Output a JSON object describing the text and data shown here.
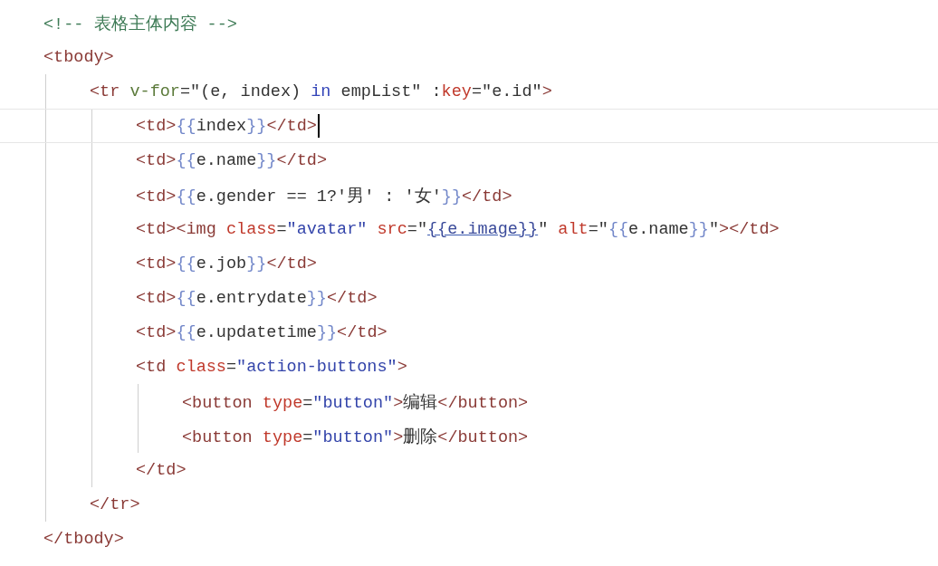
{
  "code_lines": [
    {
      "tokens": [
        {
          "kind": "comment",
          "text": "<!-- 表格主体内容 -->"
        }
      ]
    },
    {
      "tokens": [
        {
          "kind": "tag",
          "text": "<tbody>"
        }
      ],
      "children": [
        {
          "tokens": [
            {
              "kind": "tag",
              "text": "<tr "
            },
            {
              "kind": "directive",
              "text": "v-for"
            },
            {
              "kind": "plain",
              "text": "=\"(e, index) "
            },
            {
              "kind": "keyword",
              "text": "in"
            },
            {
              "kind": "plain",
              "text": " empList\" :"
            },
            {
              "kind": "attr",
              "text": "key"
            },
            {
              "kind": "plain",
              "text": "=\"e.id\""
            },
            {
              "kind": "tag",
              "text": ">"
            }
          ],
          "children": [
            {
              "current": true,
              "tokens": [
                {
                  "kind": "tag",
                  "text": "<td>"
                },
                {
                  "kind": "brace",
                  "text": "{{"
                },
                {
                  "kind": "plain",
                  "text": "index"
                },
                {
                  "kind": "brace",
                  "text": "}}"
                },
                {
                  "kind": "tag",
                  "text": "</td>"
                }
              ]
            },
            {
              "tokens": [
                {
                  "kind": "tag",
                  "text": "<td>"
                },
                {
                  "kind": "brace",
                  "text": "{{"
                },
                {
                  "kind": "plain",
                  "text": "e.name"
                },
                {
                  "kind": "brace",
                  "text": "}}"
                },
                {
                  "kind": "tag",
                  "text": "</td>"
                }
              ]
            },
            {
              "tokens": [
                {
                  "kind": "tag",
                  "text": "<td>"
                },
                {
                  "kind": "brace",
                  "text": "{{"
                },
                {
                  "kind": "plain",
                  "text": "e.gender == 1?'男' : '女'"
                },
                {
                  "kind": "brace",
                  "text": "}}"
                },
                {
                  "kind": "tag",
                  "text": "</td>"
                }
              ]
            },
            {
              "tokens": [
                {
                  "kind": "tag",
                  "text": "<td><img "
                },
                {
                  "kind": "attr",
                  "text": "class"
                },
                {
                  "kind": "plain",
                  "text": "="
                },
                {
                  "kind": "string",
                  "text": "\"avatar\""
                },
                {
                  "kind": "attr",
                  "text": " src"
                },
                {
                  "kind": "plain",
                  "text": "=\""
                },
                {
                  "kind": "link",
                  "text": "{{e.image}}"
                },
                {
                  "kind": "plain",
                  "text": "\" "
                },
                {
                  "kind": "attr",
                  "text": "alt"
                },
                {
                  "kind": "plain",
                  "text": "=\""
                },
                {
                  "kind": "brace",
                  "text": "{{"
                },
                {
                  "kind": "plain",
                  "text": "e.name"
                },
                {
                  "kind": "brace",
                  "text": "}}"
                },
                {
                  "kind": "plain",
                  "text": "\""
                },
                {
                  "kind": "tag",
                  "text": "></td>"
                }
              ]
            },
            {
              "tokens": [
                {
                  "kind": "tag",
                  "text": "<td>"
                },
                {
                  "kind": "brace",
                  "text": "{{"
                },
                {
                  "kind": "plain",
                  "text": "e.job"
                },
                {
                  "kind": "brace",
                  "text": "}}"
                },
                {
                  "kind": "tag",
                  "text": "</td>"
                }
              ]
            },
            {
              "tokens": [
                {
                  "kind": "tag",
                  "text": "<td>"
                },
                {
                  "kind": "brace",
                  "text": "{{"
                },
                {
                  "kind": "plain",
                  "text": "e.entrydate"
                },
                {
                  "kind": "brace",
                  "text": "}}"
                },
                {
                  "kind": "tag",
                  "text": "</td>"
                }
              ]
            },
            {
              "tokens": [
                {
                  "kind": "tag",
                  "text": "<td>"
                },
                {
                  "kind": "brace",
                  "text": "{{"
                },
                {
                  "kind": "plain",
                  "text": "e.updatetime"
                },
                {
                  "kind": "brace",
                  "text": "}}"
                },
                {
                  "kind": "tag",
                  "text": "</td>"
                }
              ]
            },
            {
              "tokens": [
                {
                  "kind": "tag",
                  "text": "<td "
                },
                {
                  "kind": "attr",
                  "text": "class"
                },
                {
                  "kind": "plain",
                  "text": "="
                },
                {
                  "kind": "string",
                  "text": "\"action-buttons\""
                },
                {
                  "kind": "tag",
                  "text": ">"
                }
              ],
              "children": [
                {
                  "tokens": [
                    {
                      "kind": "tag",
                      "text": "<button "
                    },
                    {
                      "kind": "attr",
                      "text": "type"
                    },
                    {
                      "kind": "plain",
                      "text": "="
                    },
                    {
                      "kind": "string",
                      "text": "\"button\""
                    },
                    {
                      "kind": "tag",
                      "text": ">"
                    },
                    {
                      "kind": "plain",
                      "text": "编辑"
                    },
                    {
                      "kind": "tag",
                      "text": "</button>"
                    }
                  ]
                },
                {
                  "tokens": [
                    {
                      "kind": "tag",
                      "text": "<button "
                    },
                    {
                      "kind": "attr",
                      "text": "type"
                    },
                    {
                      "kind": "plain",
                      "text": "="
                    },
                    {
                      "kind": "string",
                      "text": "\"button\""
                    },
                    {
                      "kind": "tag",
                      "text": ">"
                    },
                    {
                      "kind": "plain",
                      "text": "删除"
                    },
                    {
                      "kind": "tag",
                      "text": "</button>"
                    }
                  ]
                }
              ]
            },
            {
              "tokens": [
                {
                  "kind": "tag",
                  "text": "</td>"
                }
              ]
            }
          ]
        },
        {
          "tokens": [
            {
              "kind": "tag",
              "text": "</tr>"
            }
          ]
        }
      ]
    },
    {
      "tokens": [
        {
          "kind": "tag",
          "text": "</tbody>"
        }
      ]
    }
  ]
}
